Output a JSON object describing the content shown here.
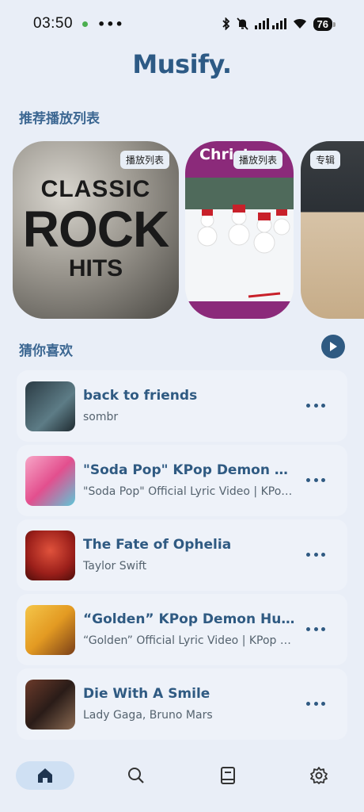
{
  "status_bar": {
    "time": "03:50",
    "more": "•••",
    "battery": "76"
  },
  "header": {
    "title": "Musify."
  },
  "recommended": {
    "title": "推荐播放列表",
    "cards": [
      {
        "badge": "播放列表",
        "cover_lines": [
          "CLASSIC",
          "ROCK",
          "HITS"
        ]
      },
      {
        "badge": "播放列表",
        "cover_text": "Christ"
      },
      {
        "badge": "专辑"
      }
    ]
  },
  "guess": {
    "title": "猜你喜欢",
    "songs": [
      {
        "title": "back to friends",
        "subtitle": "sombr"
      },
      {
        "title": "\"Soda Pop\"   KPop Demon Hunters | Sony Animation",
        "subtitle": "\"Soda Pop\" Official Lyric Video | KPop Demon Hunters"
      },
      {
        "title": "The Fate of Ophelia",
        "subtitle": "Taylor Swift"
      },
      {
        "title": "“Golden”   KPop Demon Hunters | Sony Animation",
        "subtitle": "“Golden” Official Lyric Video | KPop Demon Hunters"
      },
      {
        "title": "Die With A Smile",
        "subtitle": "Lady Gaga, Bruno Mars"
      }
    ]
  },
  "nav": {
    "items": [
      "home",
      "search",
      "library",
      "settings"
    ]
  },
  "colors": {
    "accent": "#2f5a82",
    "background": "#e9eef7",
    "nav_active": "#cfe0f3"
  }
}
